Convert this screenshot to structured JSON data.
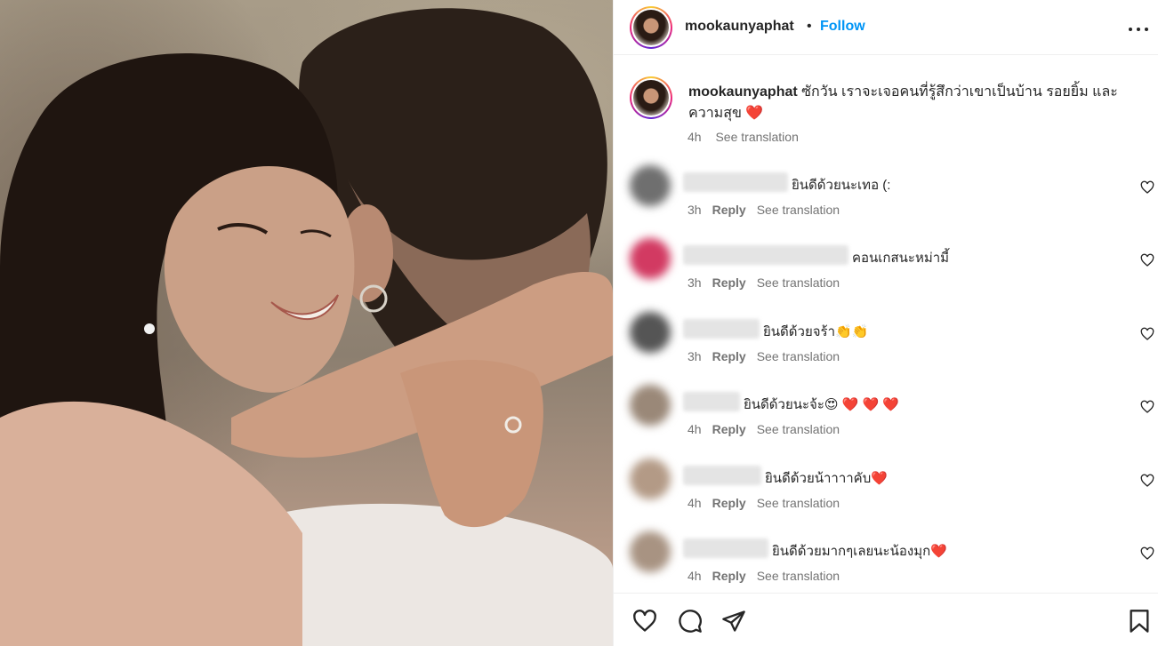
{
  "post": {
    "username": "mookaunyaphat",
    "dot": "•",
    "follow_label": "Follow",
    "caption_text": "ซักวัน เราจะเจอคนที่รู้สึกว่าเขาเป็นบ้าน รอยยิ้ม และ ความสุข ❤️",
    "time": "4h",
    "see_translation": "See translation"
  },
  "comments": [
    {
      "text": "ยินดีด้วยนะเทอ (:",
      "time": "3h",
      "reply": "Reply",
      "translate": "See translation",
      "avatar_color": "#6f6f6f"
    },
    {
      "text": "คอนเกสนะหม่ามี้",
      "time": "3h",
      "reply": "Reply",
      "translate": "See translation",
      "avatar_color": "#d23a62"
    },
    {
      "text": "ยินดีด้วยจร้า👏👏",
      "time": "3h",
      "reply": "Reply",
      "translate": "See translation",
      "avatar_color": "#555555"
    },
    {
      "text": "ยินดีด้วยนะจ้ะ😍 ❤️ ❤️ ❤️",
      "time": "4h",
      "reply": "Reply",
      "translate": "See translation",
      "avatar_color": "#9a8878"
    },
    {
      "text": "ยินดีด้วยน้าาาาคับ❤️",
      "time": "4h",
      "reply": "Reply",
      "translate": "See translation",
      "avatar_color": "#b39a86"
    },
    {
      "text": "ยินดีด้วยมากๆเลยนะน้องมุก❤️",
      "time": "4h",
      "reply": "Reply",
      "translate": "See translation",
      "avatar_color": "#a89382"
    }
  ],
  "icons": {
    "like": "heart-icon",
    "comment": "comment-icon",
    "share": "share-icon",
    "save": "bookmark-icon",
    "more": "more-icon"
  },
  "colors": {
    "follow": "#0095f6",
    "meta": "#737373",
    "text": "#262626"
  }
}
